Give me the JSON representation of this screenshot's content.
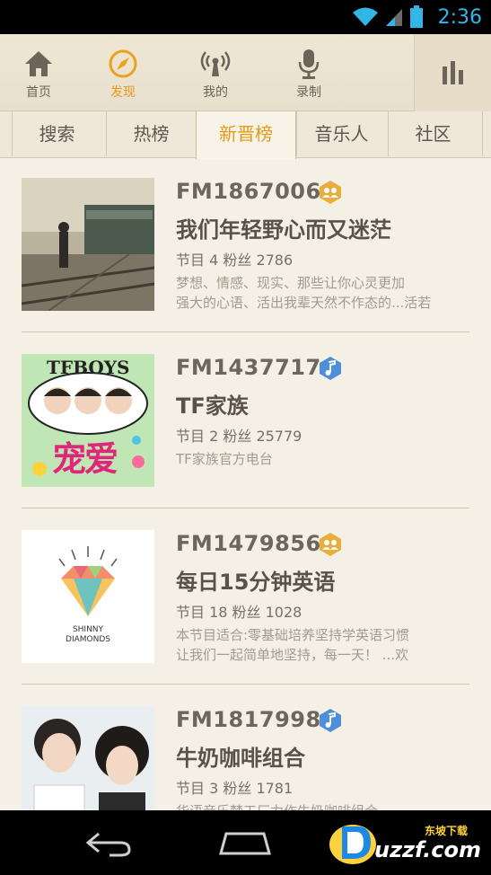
{
  "status_bar": {
    "time": "2:36"
  },
  "top_nav": [
    {
      "label": "首页",
      "icon": "home-icon"
    },
    {
      "label": "发现",
      "icon": "compass-icon",
      "active": true
    },
    {
      "label": "我的",
      "icon": "radio-broadcast-icon"
    },
    {
      "label": "录制",
      "icon": "microphone-icon"
    }
  ],
  "tabs": [
    {
      "label": "搜索"
    },
    {
      "label": "热榜"
    },
    {
      "label": "新晋榜",
      "active": true
    },
    {
      "label": "音乐人"
    },
    {
      "label": "社区"
    }
  ],
  "stats_prefix": {
    "episodes": "节目",
    "fans": "粉丝"
  },
  "items": [
    {
      "fm": "FM1867006",
      "badge": "group-badge-icon",
      "title": "我们年轻野心而又迷茫",
      "stats": "节目 4   粉丝 2786",
      "desc1": "梦想、情感、现实、那些让你心灵更加",
      "desc2": "强大的心语、活出我辈天然不作态的...活若"
    },
    {
      "fm": "FM1437717",
      "badge": "music-note-badge-icon",
      "title": "TF家族",
      "stats": "节目 2   粉丝 25779",
      "desc1": "TF家族官方电台",
      "desc2": "",
      "thumb_text_top": "TFBOYS",
      "thumb_text_bottom": "宠爱"
    },
    {
      "fm": "FM1479856",
      "badge": "group-badge-icon",
      "title": "每日15分钟英语",
      "stats": "节目 18   粉丝 1028",
      "desc1": "本节目适合:零基础培养坚持学英语习惯",
      "desc2": "让我们一起简单地坚持，每一天！ ...欢",
      "thumb_text": "SHINNY DIAMONDS"
    },
    {
      "fm": "FM1817998",
      "badge": "music-note-badge-icon",
      "title": "牛奶咖啡组合",
      "stats": "节目 3   粉丝 1781",
      "desc1": "华语音乐梦工厂力作牛奶咖啡组合",
      "desc2": ""
    }
  ],
  "watermark": {
    "brand": "uzzf.com",
    "tag": "东坡下载"
  },
  "colors": {
    "accent": "#e39b1a",
    "background": "#f5f0e6",
    "status_time": "#33b5e5",
    "badge_gold": "#e8ae3c",
    "badge_blue": "#4d8fd8"
  }
}
